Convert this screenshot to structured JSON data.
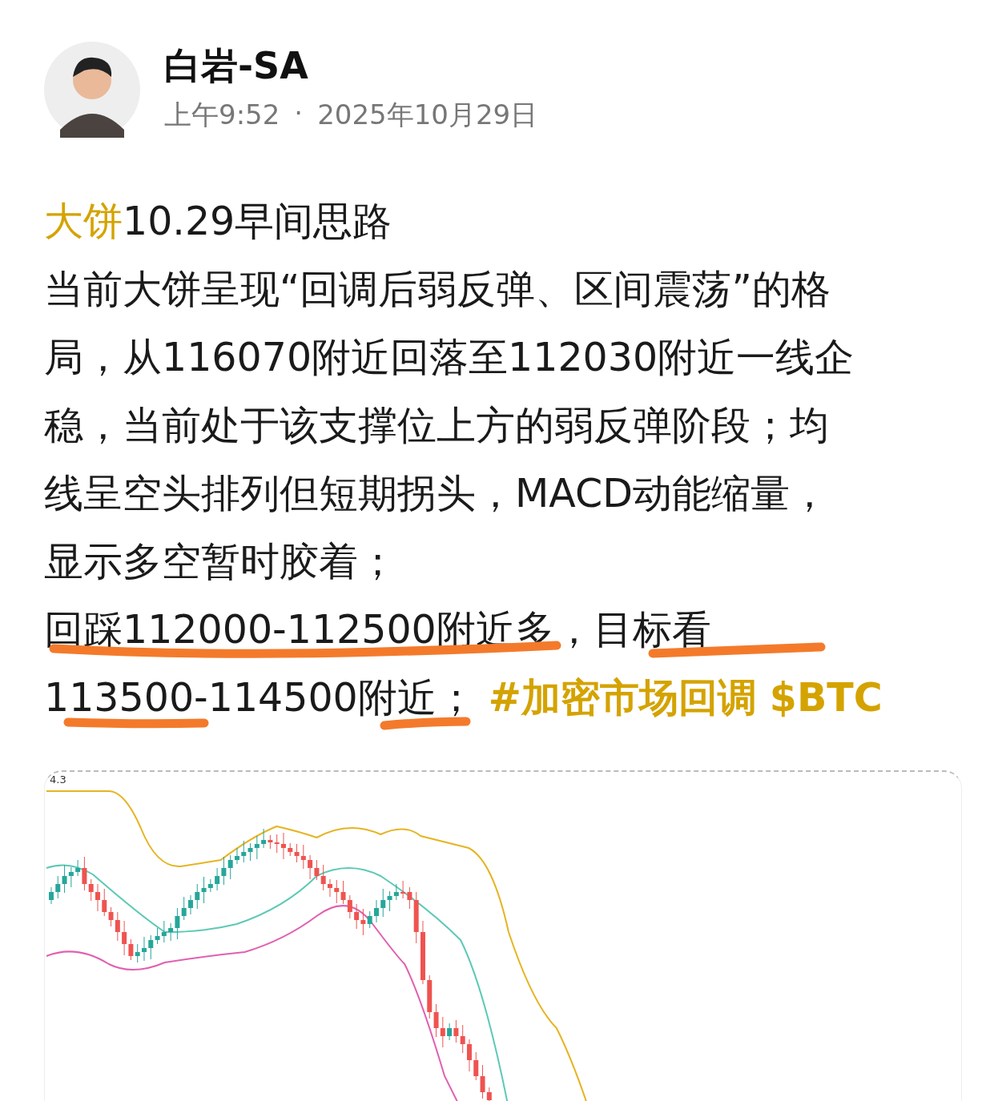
{
  "author": {
    "name": "白岩-SA",
    "time": "上午9:52",
    "separator": "·",
    "date": "2025年10月29日"
  },
  "post": {
    "title_highlight": "大饼",
    "title": "10.29早间思路",
    "lines": [
      "当前大饼呈现“回调后弱反弹、区间震荡”的格",
      "局，从116070附近回落至112030附近一线企",
      "稳，当前处于该支撑位上方的弱反弹阶段；均",
      "线呈空头排列但短期拐头，MACD动能缩量，",
      "显示多空暂时胶着；",
      "回踩112000-112500附近多，目标看",
      "113500-114500附近；"
    ],
    "tags": [
      "#加密市场回调",
      "$BTC"
    ]
  },
  "chart": {
    "tick_label": "4.3"
  }
}
